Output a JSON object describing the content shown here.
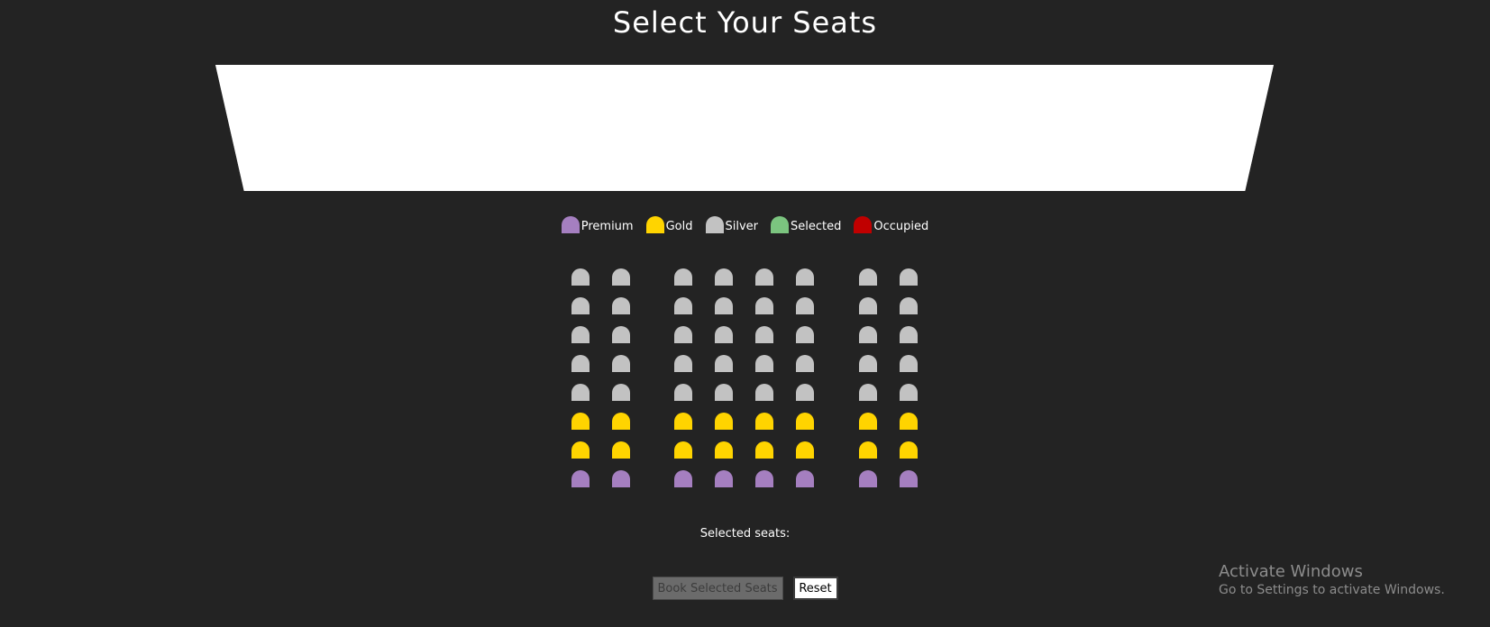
{
  "page": {
    "title": "Select Your Seats"
  },
  "legend": [
    {
      "label": "Premium",
      "color": "#a57fc0",
      "icon": "seat-premium-icon"
    },
    {
      "label": "Gold",
      "color": "#ffd400",
      "icon": "seat-gold-icon"
    },
    {
      "label": "Silver",
      "color": "#c2c2c2",
      "icon": "seat-silver-icon"
    },
    {
      "label": "Selected",
      "color": "#7bc47f",
      "icon": "seat-selected-icon"
    },
    {
      "label": "Occupied",
      "color": "#c00000",
      "icon": "seat-occupied-icon"
    }
  ],
  "seat_map": {
    "rows": [
      {
        "tier": "silver"
      },
      {
        "tier": "silver"
      },
      {
        "tier": "silver"
      },
      {
        "tier": "silver"
      },
      {
        "tier": "silver"
      },
      {
        "tier": "gold"
      },
      {
        "tier": "gold"
      },
      {
        "tier": "premium"
      }
    ],
    "seats_per_row": 8,
    "section_sizes": [
      2,
      4,
      2
    ]
  },
  "selection": {
    "label": "Selected seats:",
    "value": ""
  },
  "actions": {
    "book_label": "Book Selected Seats",
    "reset_label": "Reset"
  },
  "watermark": {
    "title": "Activate Windows",
    "subtitle": "Go to Settings to activate Windows."
  },
  "colors": {
    "background": "#232323",
    "screen": "#ffffff"
  }
}
